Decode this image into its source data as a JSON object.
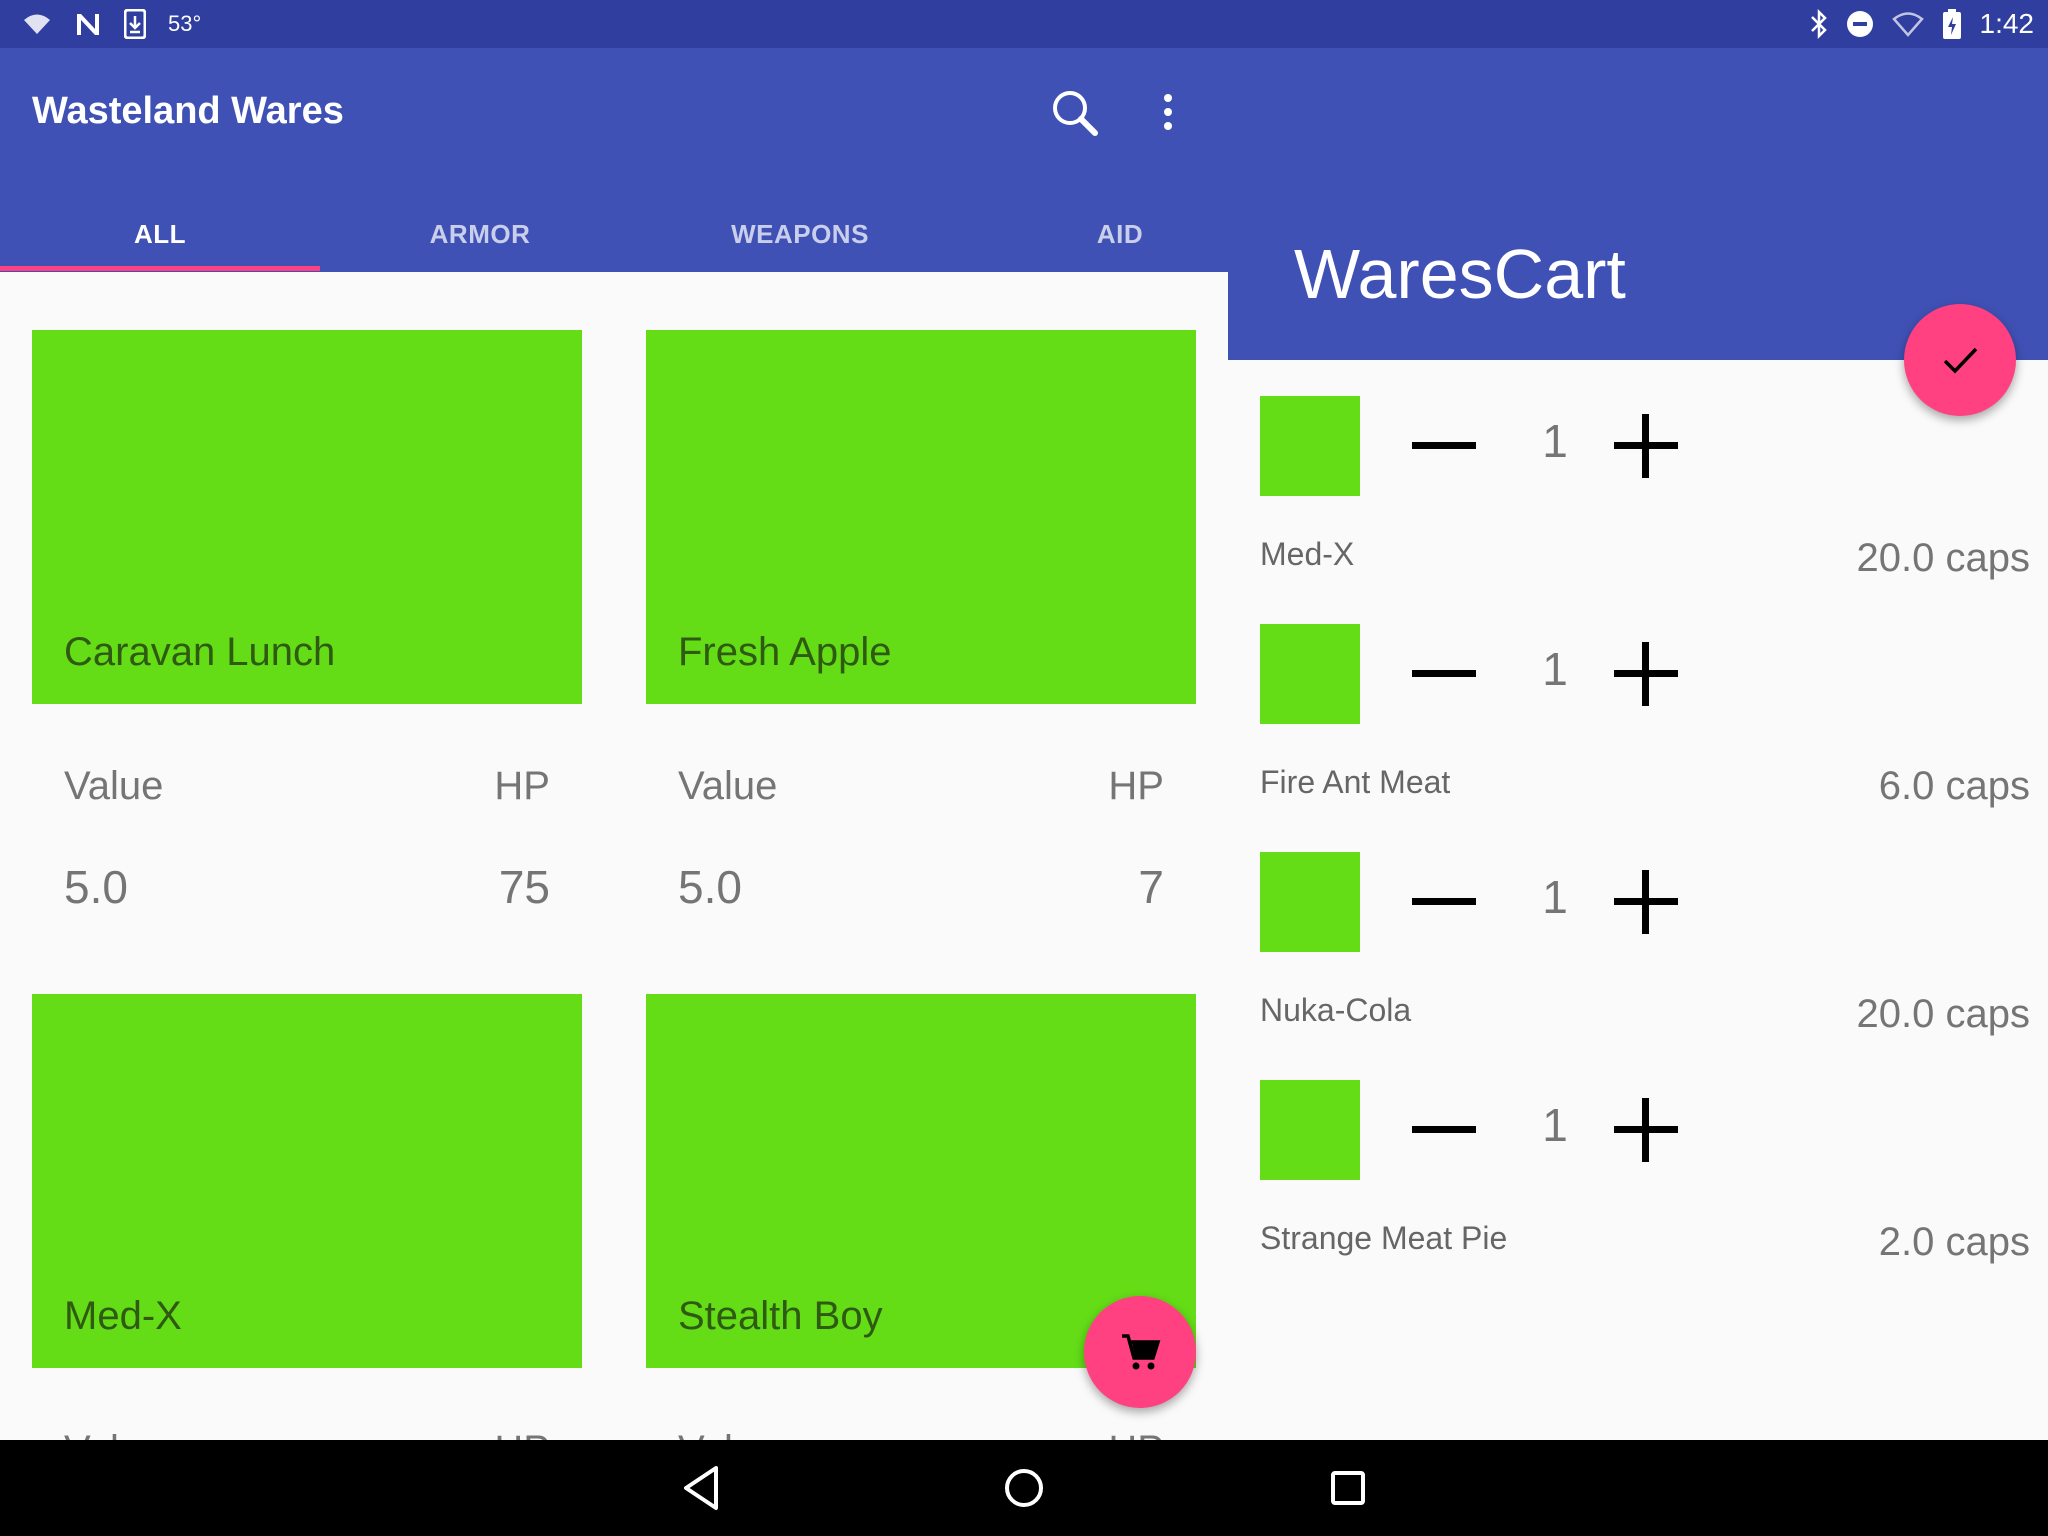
{
  "status_bar": {
    "temperature": "53°",
    "time": "1:42"
  },
  "app": {
    "title": "Wasteland Wares"
  },
  "toolbar": {
    "search_icon": "search-icon",
    "more_icon": "more-vert-icon"
  },
  "tabs": [
    {
      "label": "ALL",
      "active": true
    },
    {
      "label": "ARMOR",
      "active": false
    },
    {
      "label": "WEAPONS",
      "active": false
    },
    {
      "label": "AID",
      "active": false
    }
  ],
  "products": [
    {
      "name": "Caravan Lunch",
      "value_label": "Value",
      "stat_label": "HP",
      "value": "5.0",
      "stat": "75"
    },
    {
      "name": "Fresh Apple",
      "value_label": "Value",
      "stat_label": "HP",
      "value": "5.0",
      "stat": "7"
    },
    {
      "name": "Med-X",
      "value_label": "Value",
      "stat_label": "HP",
      "value": "",
      "stat": ""
    },
    {
      "name": "Stealth Boy",
      "value_label": "Value",
      "stat_label": "HP",
      "value": "",
      "stat": ""
    }
  ],
  "cart": {
    "title": "WaresCart",
    "items": [
      {
        "name": "Med-X",
        "quantity": "1",
        "price": "20.0 caps"
      },
      {
        "name": "Fire Ant Meat",
        "quantity": "1",
        "price": "6.0 caps"
      },
      {
        "name": "Nuka-Cola",
        "quantity": "1",
        "price": "20.0 caps"
      },
      {
        "name": "Strange Meat Pie",
        "quantity": "1",
        "price": "2.0 caps"
      }
    ]
  },
  "colors": {
    "primary": "#3f51b5",
    "primary_dark": "#303f9f",
    "accent": "#ff4081",
    "item_placeholder": "#64dd17"
  }
}
